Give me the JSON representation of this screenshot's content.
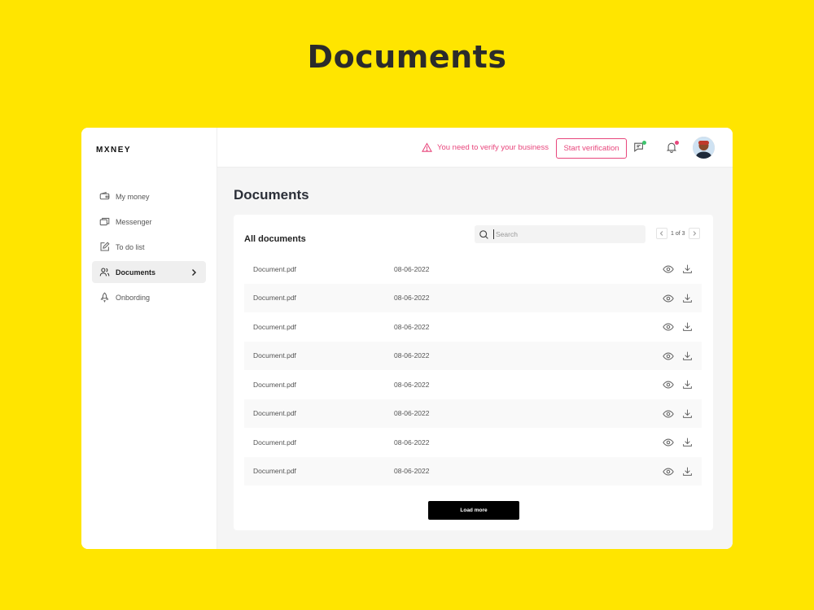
{
  "hero": {
    "title": "Documents"
  },
  "app": {
    "logo": "MXNEY",
    "sidebar": {
      "items": [
        {
          "label": "My money",
          "icon": "wallet-icon"
        },
        {
          "label": "Messenger",
          "icon": "messages-icon"
        },
        {
          "label": "To do list",
          "icon": "edit-icon"
        },
        {
          "label": "Documents",
          "icon": "users-icon",
          "active": true
        },
        {
          "label": "Onbording",
          "icon": "rocket-icon"
        }
      ]
    },
    "topbar": {
      "warning_text": "You need to verify your business",
      "verify_button": "Start verification",
      "accent_color": "#e8467c"
    },
    "page_title": "Documents",
    "card": {
      "title": "All documents",
      "search_placeholder": "Search",
      "pager_text": "1 of 3",
      "rows": [
        {
          "name": "Document.pdf",
          "date": "08-06-2022"
        },
        {
          "name": "Document.pdf",
          "date": "08-06-2022"
        },
        {
          "name": "Document.pdf",
          "date": "08-06-2022"
        },
        {
          "name": "Document.pdf",
          "date": "08-06-2022"
        },
        {
          "name": "Document.pdf",
          "date": "08-06-2022"
        },
        {
          "name": "Document.pdf",
          "date": "08-06-2022"
        },
        {
          "name": "Document.pdf",
          "date": "08-06-2022"
        },
        {
          "name": "Document.pdf",
          "date": "08-06-2022"
        }
      ],
      "load_more": "Load more"
    }
  }
}
